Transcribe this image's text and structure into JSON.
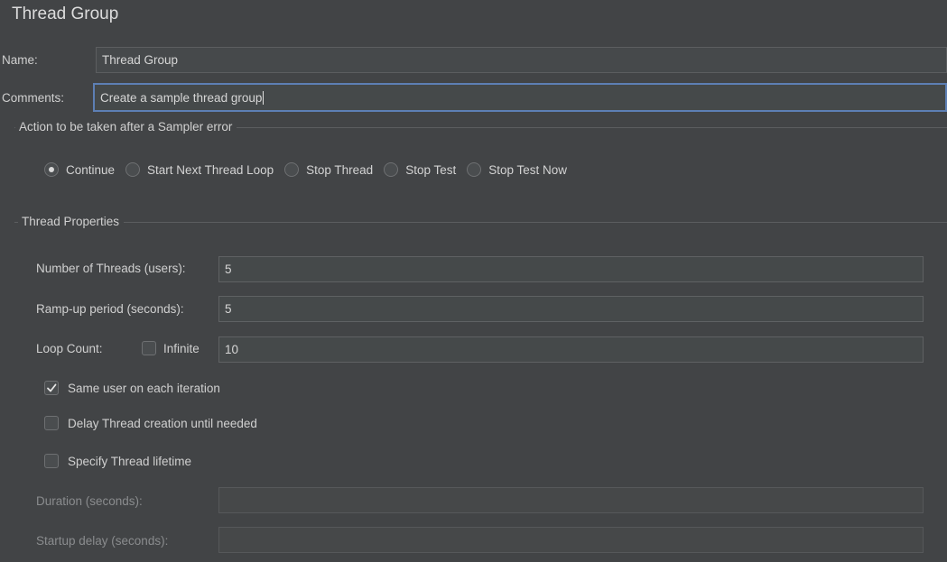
{
  "panel": {
    "title": "Thread Group"
  },
  "name_field": {
    "label": "Name:",
    "value": "Thread Group"
  },
  "comments_field": {
    "label": "Comments:",
    "value": "Create a sample thread group"
  },
  "sampler_error": {
    "section_title": "Action to be taken after a Sampler error",
    "options": [
      {
        "label": "Continue",
        "selected": true
      },
      {
        "label": "Start Next Thread Loop",
        "selected": false
      },
      {
        "label": "Stop Thread",
        "selected": false
      },
      {
        "label": "Stop Test",
        "selected": false
      },
      {
        "label": "Stop Test Now",
        "selected": false
      }
    ]
  },
  "thread_properties": {
    "section_title": "Thread Properties",
    "num_threads": {
      "label": "Number of Threads (users):",
      "value": "5"
    },
    "ramp_up": {
      "label": "Ramp-up period (seconds):",
      "value": "5"
    },
    "loop_count": {
      "label": "Loop Count:",
      "infinite_label": "Infinite",
      "infinite_checked": false,
      "value": "10"
    },
    "same_user": {
      "label": "Same user on each iteration",
      "checked": true
    },
    "delay_creation": {
      "label": "Delay Thread creation until needed",
      "checked": false
    },
    "specify_lifetime": {
      "label": "Specify Thread lifetime",
      "checked": false
    },
    "duration": {
      "label": "Duration (seconds):",
      "value": ""
    },
    "startup_delay": {
      "label": "Startup delay (seconds):",
      "value": ""
    }
  }
}
